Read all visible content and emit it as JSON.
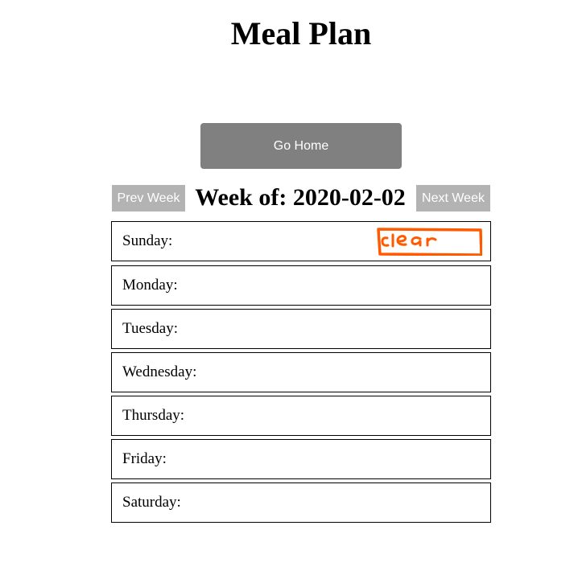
{
  "page": {
    "title": "Meal Plan"
  },
  "home_button": {
    "label": "Go Home"
  },
  "week_nav": {
    "prev_label": "Prev Week",
    "next_label": "Next Week",
    "heading_prefix": "Week of: ",
    "week_date": "2020-02-02",
    "heading": "Week of: 2020-02-02"
  },
  "days": [
    {
      "label": "Sunday:",
      "has_clear": true
    },
    {
      "label": "Monday:",
      "has_clear": false
    },
    {
      "label": "Tuesday:",
      "has_clear": false
    },
    {
      "label": "Wednesday:",
      "has_clear": false
    },
    {
      "label": "Thursday:",
      "has_clear": false
    },
    {
      "label": "Friday:",
      "has_clear": false
    },
    {
      "label": "Saturday:",
      "has_clear": false
    }
  ],
  "clear_annotation": {
    "text": "clear",
    "color": "#ff5a00"
  },
  "colors": {
    "home_button_bg": "#808080",
    "nav_button_bg": "#b3b3b3",
    "border": "#000000"
  }
}
